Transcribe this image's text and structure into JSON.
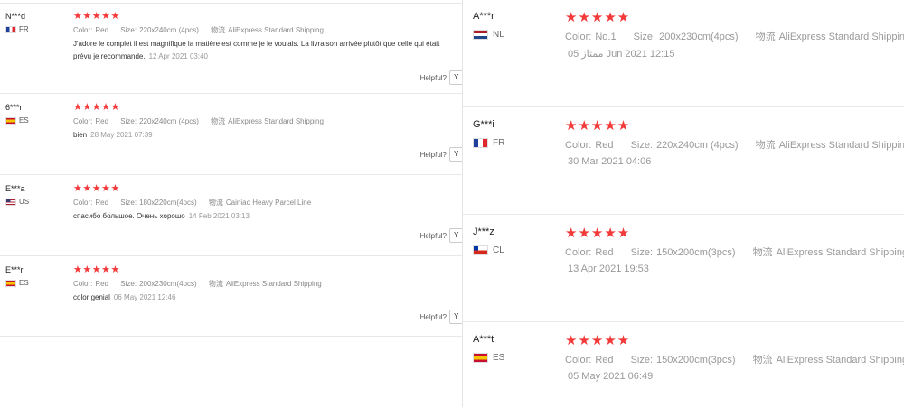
{
  "left_reviews": [
    {
      "user": "N***d",
      "country": "FR",
      "flag_icon": "france-flag-icon",
      "stars": "★★★★★",
      "color_label": "Color:",
      "color_value": "Red",
      "size_label": "Size:",
      "size_value": "220x240cm (4pcs)",
      "ship_label": "物流",
      "ship_value": "AliExpress Standard Shipping",
      "feedback_line1": "J'adore le complet il est magnifique la matière est comme je le voulais. La livraison arrivée plutôt que celle qui était",
      "feedback_line2": "prévu je recommande.",
      "date": "12 Apr 2021 03:40",
      "helpful_label": "Helpful?",
      "yes_label": "Y"
    },
    {
      "user": "6***r",
      "country": "ES",
      "flag_icon": "spain-flag-icon",
      "stars": "★★★★★",
      "color_label": "Color:",
      "color_value": "Red",
      "size_label": "Size:",
      "size_value": "220x240cm (4pcs)",
      "ship_label": "物流",
      "ship_value": "AliExpress Standard Shipping",
      "feedback_line1": "bien",
      "date": "28 May 2021 07:39",
      "helpful_label": "Helpful?",
      "yes_label": "Y"
    },
    {
      "user": "E***a",
      "country": "US",
      "flag_icon": "usa-flag-icon",
      "stars": "★★★★★",
      "color_label": "Color:",
      "color_value": "Red",
      "size_label": "Size:",
      "size_value": "180x220cm(4pcs)",
      "ship_label": "物流",
      "ship_value": "Cainiao Heavy Parcel Line",
      "feedback_line1": "спасибо большое. Очень хорошо",
      "date": "14 Feb 2021 03:13",
      "helpful_label": "Helpful?",
      "yes_label": "Y"
    },
    {
      "user": "E***r",
      "country": "ES",
      "flag_icon": "spain-flag-icon",
      "stars": "★★★★★",
      "color_label": "Color:",
      "color_value": "Red",
      "size_label": "Size:",
      "size_value": "200x230cm(4pcs)",
      "ship_label": "物流",
      "ship_value": "AliExpress Standard Shipping",
      "feedback_line1": "color genial",
      "date": "06 May 2021 12:46",
      "helpful_label": "Helpful?",
      "yes_label": "Y"
    }
  ],
  "right_reviews": [
    {
      "user": "A***r",
      "country": "NL",
      "flag_icon": "netherlands-flag-icon",
      "stars": "★★★★★",
      "color_label": "Color:",
      "color_value": "No.1",
      "size_label": "Size:",
      "size_value": "200x230cm(4pcs)",
      "ship_label": "物流",
      "ship_value": "AliExpress Standard Shipping",
      "date": "05 ممتاز Jun 2021 12:15"
    },
    {
      "user": "G***i",
      "country": "FR",
      "flag_icon": "france-flag-icon",
      "stars": "★★★★★",
      "color_label": "Color:",
      "color_value": "Red",
      "size_label": "Size:",
      "size_value": "220x240cm (4pcs)",
      "ship_label": "物流",
      "ship_value": "AliExpress Standard Shipping",
      "date": "30 Mar 2021 04:06"
    },
    {
      "user": "J***z",
      "country": "CL",
      "flag_icon": "chile-flag-icon",
      "stars": "★★★★★",
      "color_label": "Color:",
      "color_value": "Red",
      "size_label": "Size:",
      "size_value": "150x200cm(3pcs)",
      "ship_label": "物流",
      "ship_value": "AliExpress Standard Shipping",
      "date": "13 Apr 2021 19:53"
    },
    {
      "user": "A***t",
      "country": "ES",
      "flag_icon": "spain-flag-icon",
      "stars": "★★★★★",
      "color_label": "Color:",
      "color_value": "Red",
      "size_label": "Size:",
      "size_value": "150x200cm(3pcs)",
      "ship_label": "物流",
      "ship_value": "AliExpress Standard Shipping",
      "date": "05 May 2021 06:49"
    }
  ],
  "colors": {
    "star": "#f23a3a",
    "muted_text": "#999999",
    "divider": "#e8e8e8"
  }
}
